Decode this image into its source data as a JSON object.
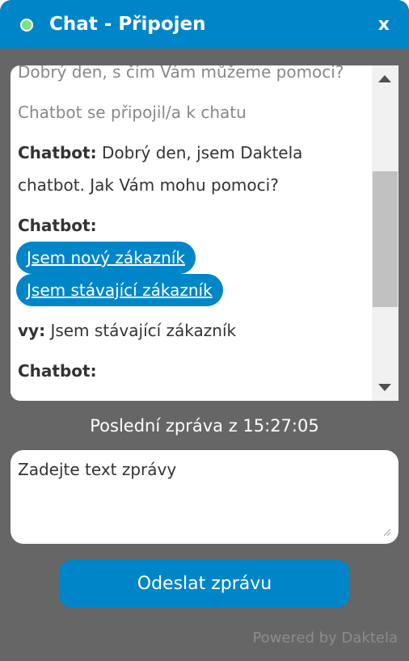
{
  "header": {
    "title": "Chat - Připojen",
    "close_label": "x",
    "status_color": "#7ee07e",
    "accent_color": "#0086c8"
  },
  "messages": [
    {
      "type": "system",
      "text": "Dobrý den, s čím Vám můžeme pomoci?"
    },
    {
      "type": "system",
      "text": "Chatbot se připojil/a k chatu"
    },
    {
      "type": "message",
      "sender": "Chatbot:",
      "text": "Dobrý den, jsem Daktela chatbot. Jak Vám mohu pomoci?"
    },
    {
      "type": "message",
      "sender": "Chatbot:",
      "text": ""
    },
    {
      "type": "options",
      "options": [
        "Jsem nový zákazník",
        "Jsem stávající zákazník"
      ]
    },
    {
      "type": "message",
      "sender": "vy:",
      "text": "Jsem stávající zákazník"
    },
    {
      "type": "message",
      "sender": "Chatbot:",
      "text": ""
    }
  ],
  "status": {
    "last_message": "Poslední zpráva z 15:27:05"
  },
  "composer": {
    "placeholder": "Zadejte text zprávy",
    "value": "",
    "send_label": "Odeslat zprávu"
  },
  "footer": {
    "powered_by": "Powered by Daktela"
  }
}
